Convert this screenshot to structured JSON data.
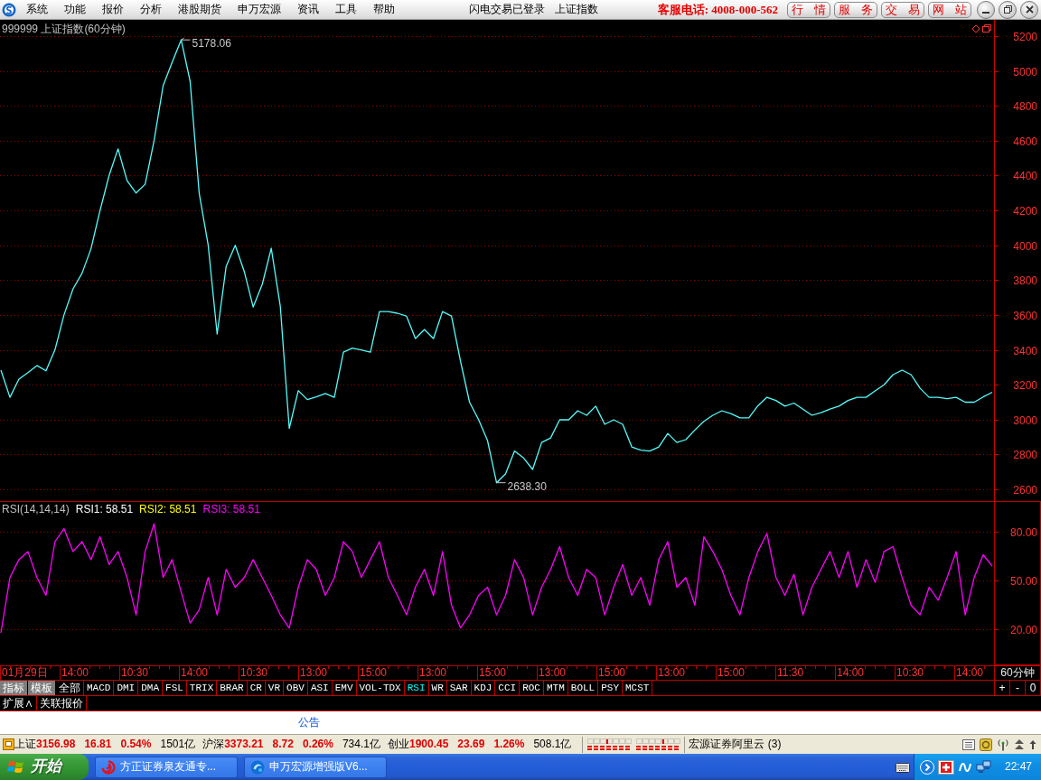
{
  "menu_bar": {
    "items": [
      "系统",
      "功能",
      "报价",
      "分析",
      "港股期货",
      "申万宏源",
      "资讯",
      "工具",
      "帮助"
    ],
    "login_status": "闪电交易已登录",
    "index_name": "上证指数",
    "hotline": "客服电话: 4008-000-562",
    "quick_buttons": [
      "行 情",
      "服 务",
      "交 易",
      "网 站"
    ]
  },
  "price_panel": {
    "chart_data": {
      "type": "line",
      "title": "999999 上证指数(60分钟)",
      "ylim": [
        2533,
        5293
      ],
      "yticks": [
        2600,
        2800,
        3000,
        3200,
        3400,
        3600,
        3800,
        4000,
        4200,
        4400,
        4600,
        4800,
        5000,
        5200
      ],
      "grid": true,
      "series": [
        {
          "color": "#54fcfc",
          "values": [
            3284,
            3128,
            3232,
            3270,
            3310,
            3280,
            3400,
            3600,
            3750,
            3840,
            3980,
            4200,
            4400,
            4553,
            4371,
            4300,
            4350,
            4600,
            4915,
            5050,
            5178,
            4941,
            4300,
            4000,
            3491,
            3880,
            4000,
            3850,
            3646,
            3776,
            3983,
            3650,
            2950,
            3167,
            3115,
            3130,
            3150,
            3128,
            3387,
            3410,
            3400,
            3387,
            3620,
            3620,
            3610,
            3594,
            3465,
            3517,
            3465,
            3620,
            3594,
            3335,
            3100,
            3000,
            2880,
            2638,
            2690,
            2820,
            2780,
            2714,
            2869,
            2895,
            2999,
            2999,
            3051,
            3025,
            3077,
            2973,
            2999,
            2973,
            2843,
            2825,
            2820,
            2843,
            2921,
            2869,
            2885,
            2940,
            2990,
            3025,
            3051,
            3035,
            3010,
            3010,
            3080,
            3128,
            3110,
            3077,
            3095,
            3060,
            3025,
            3040,
            3060,
            3077,
            3110,
            3128,
            3128,
            3165,
            3200,
            3258,
            3284,
            3258,
            3180,
            3128,
            3128,
            3120,
            3128,
            3100,
            3100,
            3130,
            3157
          ]
        }
      ],
      "annotations": [
        "5178.06",
        "2638.30"
      ]
    }
  },
  "rsi_panel": {
    "legend": [
      {
        "text": "RSI(14,14,14)",
        "color": "#c0c0c0"
      },
      {
        "text": "RSI1: 58.51",
        "color": "#ffffff"
      },
      {
        "text": "RSI2: 58.51",
        "color": "#ffff00"
      },
      {
        "text": "RSI3: 58.51",
        "color": "#ff00ff"
      }
    ],
    "chart_data": {
      "type": "line",
      "ylim": [
        -2,
        99
      ],
      "yticks": [
        {
          "value": 20,
          "label": "20.00"
        },
        {
          "value": 50,
          "label": "50.00"
        },
        {
          "value": 80,
          "label": "80.00"
        }
      ],
      "grid": true,
      "series": [
        {
          "color": "#ff00ff",
          "values": [
            18,
            52,
            63,
            68,
            52,
            41,
            74,
            82,
            68,
            74,
            63,
            77,
            60,
            68,
            52,
            29,
            68,
            85,
            52,
            63,
            43,
            24,
            32,
            52,
            29,
            57,
            46,
            52,
            63,
            52,
            41,
            29,
            21,
            46,
            63,
            57,
            41,
            52,
            74,
            68,
            52,
            63,
            74,
            52,
            41,
            29,
            46,
            57,
            41,
            68,
            35,
            21,
            29,
            41,
            46,
            29,
            41,
            63,
            52,
            29,
            46,
            57,
            71,
            52,
            41,
            57,
            52,
            29,
            46,
            60,
            41,
            52,
            35,
            63,
            74,
            46,
            52,
            35,
            77,
            68,
            57,
            41,
            29,
            52,
            68,
            79,
            52,
            41,
            54,
            29,
            46,
            57,
            68,
            52,
            68,
            46,
            63,
            49,
            68,
            71,
            52,
            35,
            29,
            46,
            38,
            52,
            68,
            29,
            52,
            66,
            59
          ]
        }
      ]
    }
  },
  "time_axis": {
    "labels": [
      "01月29日",
      "14:00",
      "10:30",
      "14:00",
      "10:30",
      "13:00",
      "15:00",
      "13:00",
      "15:00",
      "13:00",
      "15:00",
      "13:00",
      "15:00",
      "11:30",
      "14:00",
      "10:30",
      "14:00"
    ],
    "period": "60分钟"
  },
  "indicator_tabs": [
    {
      "label": "指标",
      "kind": "mode",
      "selected": false
    },
    {
      "label": "模板",
      "kind": "mode",
      "selected": false
    },
    {
      "label": "全部",
      "kind": "indicator",
      "selected": false
    },
    {
      "label": "MACD",
      "kind": "indicator",
      "selected": false
    },
    {
      "label": "DMI",
      "kind": "indicator",
      "selected": false
    },
    {
      "label": "DMA",
      "kind": "indicator",
      "selected": false
    },
    {
      "label": "FSL",
      "kind": "indicator",
      "selected": false
    },
    {
      "label": "TRIX",
      "kind": "indicator",
      "selected": false
    },
    {
      "label": "BRAR",
      "kind": "indicator",
      "selected": false
    },
    {
      "label": "CR",
      "kind": "indicator",
      "selected": false
    },
    {
      "label": "VR",
      "kind": "indicator",
      "selected": false
    },
    {
      "label": "OBV",
      "kind": "indicator",
      "selected": false
    },
    {
      "label": "ASI",
      "kind": "indicator",
      "selected": false
    },
    {
      "label": "EMV",
      "kind": "indicator",
      "selected": false
    },
    {
      "label": "VOL-TDX",
      "kind": "indicator",
      "selected": false
    },
    {
      "label": "RSI",
      "kind": "indicator",
      "selected": true
    },
    {
      "label": "WR",
      "kind": "indicator",
      "selected": false
    },
    {
      "label": "SAR",
      "kind": "indicator",
      "selected": false
    },
    {
      "label": "KDJ",
      "kind": "indicator",
      "selected": false
    },
    {
      "label": "CCI",
      "kind": "indicator",
      "selected": false
    },
    {
      "label": "ROC",
      "kind": "indicator",
      "selected": false
    },
    {
      "label": "MTM",
      "kind": "indicator",
      "selected": false
    },
    {
      "label": "BOLL",
      "kind": "indicator",
      "selected": false
    },
    {
      "label": "PSY",
      "kind": "indicator",
      "selected": false
    },
    {
      "label": "MCST",
      "kind": "indicator",
      "selected": false
    }
  ],
  "zoom_buttons": [
    "+",
    "-",
    "0"
  ],
  "panel_buttons": [
    "扩展∧",
    "关联报价"
  ],
  "notice": "公告",
  "status_bar": {
    "indices": [
      {
        "name": "上证",
        "value": "3156.98",
        "change": "16.81",
        "percent": "0.54%",
        "turnover": "1501亿"
      },
      {
        "name": "沪深",
        "value": "3373.21",
        "change": "8.72",
        "percent": "0.26%",
        "turnover": "734.1亿"
      },
      {
        "name": "创业",
        "value": "1900.45",
        "change": "23.69",
        "percent": "1.26%",
        "turnover": "508.1亿"
      }
    ],
    "server": "宏源证券阿里云 (3)"
  },
  "taskbar": {
    "start": "开始",
    "tasks": [
      {
        "label": "方正证券泉友通专...",
        "selected": false
      },
      {
        "label": "申万宏源增强版V6...",
        "selected": false
      }
    ],
    "clock": "22:47"
  }
}
